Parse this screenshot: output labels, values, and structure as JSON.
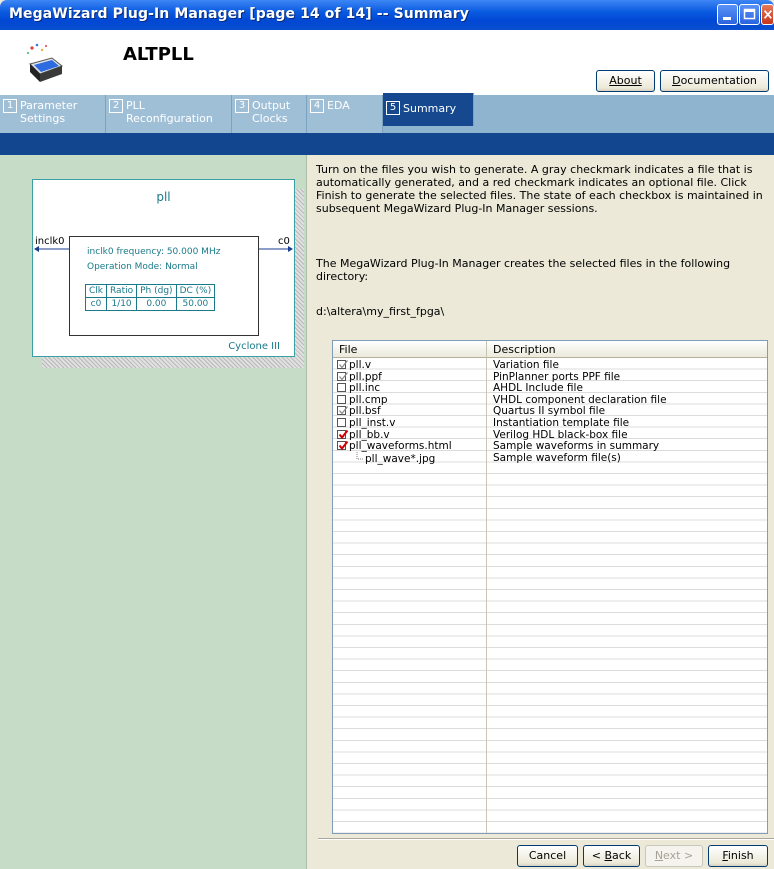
{
  "window": {
    "title": "MegaWizard Plug-In Manager [page 14 of 14] -- Summary"
  },
  "header": {
    "product": "ALTPLL",
    "about_label": "About",
    "documentation_label": "Documentation"
  },
  "tabs": [
    {
      "num": "1",
      "label": "Parameter\nSettings",
      "active": false
    },
    {
      "num": "2",
      "label": "PLL\nReconfiguration",
      "active": false
    },
    {
      "num": "3",
      "label": "Output\nClocks",
      "active": false
    },
    {
      "num": "4",
      "label": "EDA",
      "active": false
    },
    {
      "num": "5",
      "label": "Summary",
      "active": true
    }
  ],
  "symbol": {
    "name": "pll",
    "input_pin": "inclk0",
    "output_pin": "c0",
    "freq_line": "inclk0 frequency: 50.000 MHz",
    "mode_line": "Operation Mode: Normal",
    "table_headers": [
      "Clk",
      "Ratio",
      "Ph (dg)",
      "DC (%)"
    ],
    "table_row": [
      "c0",
      "1/10",
      "0.00",
      "50.00"
    ],
    "family": "Cyclone III"
  },
  "content": {
    "paragraph1": "Turn on the files you wish to generate. A gray checkmark indicates a file that is automatically generated, and a red checkmark indicates an optional file. Click Finish to generate the selected files. The state of each checkbox is maintained in subsequent MegaWizard Plug-In Manager sessions.",
    "paragraph2": "The MegaWizard Plug-In Manager creates the selected files in the following directory:",
    "directory": "d:\\altera\\my_first_fpga\\"
  },
  "file_table": {
    "col_file": "File",
    "col_description": "Description",
    "rows": [
      {
        "file": "pll.v",
        "desc": "Variation file",
        "check": "gray"
      },
      {
        "file": "pll.ppf",
        "desc": "PinPlanner ports PPF file",
        "check": "gray"
      },
      {
        "file": "pll.inc",
        "desc": "AHDL Include file",
        "check": "none"
      },
      {
        "file": "pll.cmp",
        "desc": "VHDL component declaration file",
        "check": "none"
      },
      {
        "file": "pll.bsf",
        "desc": "Quartus II symbol file",
        "check": "gray"
      },
      {
        "file": "pll_inst.v",
        "desc": "Instantiation template file",
        "check": "none"
      },
      {
        "file": "pll_bb.v",
        "desc": "Verilog HDL black-box file",
        "check": "red"
      },
      {
        "file": "pll_waveforms.html",
        "desc": "Sample waveforms in summary",
        "check": "red"
      },
      {
        "file": "pll_wave*.jpg",
        "desc": "Sample waveform file(s)",
        "check": "child"
      }
    ]
  },
  "footer": {
    "cancel_label": "Cancel",
    "back_label": "< Back",
    "next_label": "Next >",
    "finish_label": "Finish"
  },
  "colors": {
    "titlebar": "#0a5ae0",
    "tab_active": "#15488f",
    "left_panel": "#c6dcc6",
    "symbol_text": "#1a7a8a",
    "check_red": "#d00000",
    "check_gray": "#8c8c8c"
  }
}
